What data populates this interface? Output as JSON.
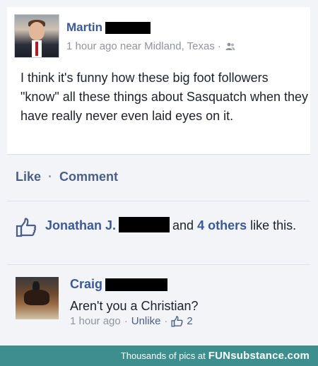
{
  "post": {
    "author_name": "Martin",
    "timestamp": "1 hour ago near Midland, Texas",
    "separator": "·",
    "audience_icon": "friends-icon",
    "text": "I think it's funny how these big foot followers \"know\" all these things about Sasquatch when they have really never even laid eyes on it."
  },
  "actions": {
    "like_label": "Like",
    "dot": "·",
    "comment_label": "Comment"
  },
  "likes": {
    "icon": "thumbs-up-icon",
    "name": "Jonathan J.",
    "and_text": "and",
    "others_text": "4 others",
    "tail_text": "like this."
  },
  "comment": {
    "author_name": "Craig",
    "text": "Aren't you a Christian?",
    "timestamp": "1 hour ago",
    "dot1": "·",
    "unlike_label": "Unlike",
    "dot2": "·",
    "like_count": "2"
  },
  "footer": {
    "prefix": "Thousands of pics at",
    "brand_bold": "FUN",
    "brand_rest": "substance",
    "brand_tld": ".com"
  },
  "colors": {
    "link_blue": "#3b5998",
    "meta_gray": "#90949c",
    "footer_teal": "#3c8f8d"
  }
}
